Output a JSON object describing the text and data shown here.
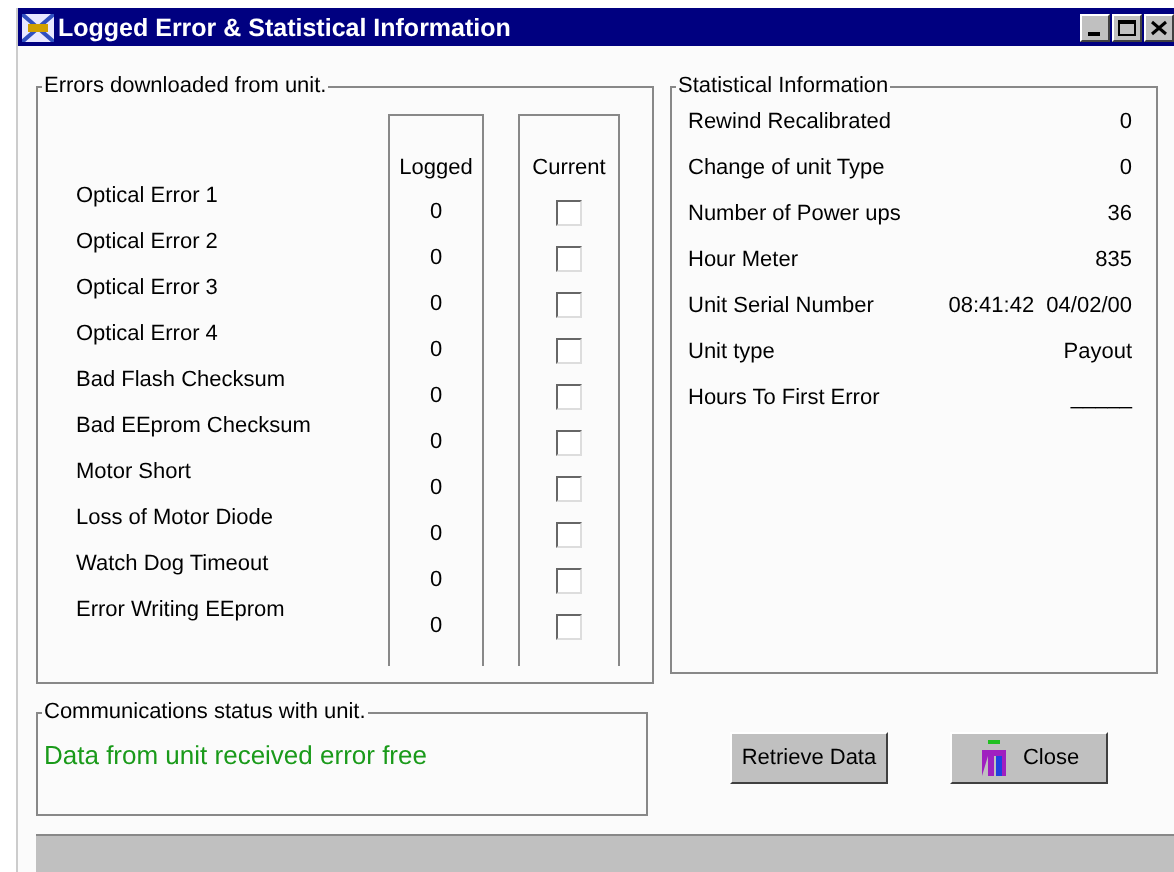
{
  "window": {
    "title": "Logged  Error & Statistical Information"
  },
  "errors": {
    "title": "Errors downloaded from unit.",
    "columns": [
      "Logged",
      "Current"
    ],
    "rows": [
      {
        "label": "Optical Error  1",
        "logged": "0",
        "checked": false
      },
      {
        "label": "Optical Error  2",
        "logged": "0",
        "checked": false
      },
      {
        "label": "Optical Error  3",
        "logged": "0",
        "checked": false
      },
      {
        "label": "Optical Error  4",
        "logged": "0",
        "checked": false
      },
      {
        "label": "Bad Flash Checksum",
        "logged": "0",
        "checked": false
      },
      {
        "label": "Bad EEprom Checksum",
        "logged": "0",
        "checked": false
      },
      {
        "label": "Motor Short",
        "logged": "0",
        "checked": false
      },
      {
        "label": "Loss of Motor Diode",
        "logged": "0",
        "checked": false
      },
      {
        "label": "Watch Dog Timeout",
        "logged": "0",
        "checked": false
      },
      {
        "label": "Error Writing EEprom",
        "logged": "0",
        "checked": false
      }
    ]
  },
  "statistics": {
    "title": "Statistical Information",
    "rows": [
      {
        "label": "Rewind Recalibrated",
        "value": "0"
      },
      {
        "label": "Change of unit Type",
        "value": "0"
      },
      {
        "label": "Number of Power ups",
        "value": "36"
      },
      {
        "label": "Hour Meter",
        "value": "835"
      },
      {
        "label": "Unit Serial Number",
        "value": "08:41:42  04/02/00"
      },
      {
        "label": "Unit type",
        "value": "Payout"
      },
      {
        "label": "Hours To First Error",
        "value": "_____"
      }
    ]
  },
  "communications": {
    "title": "Communications status with unit.",
    "message": "Data from unit received error free"
  },
  "buttons": [
    "Retrieve Data",
    "Close"
  ]
}
